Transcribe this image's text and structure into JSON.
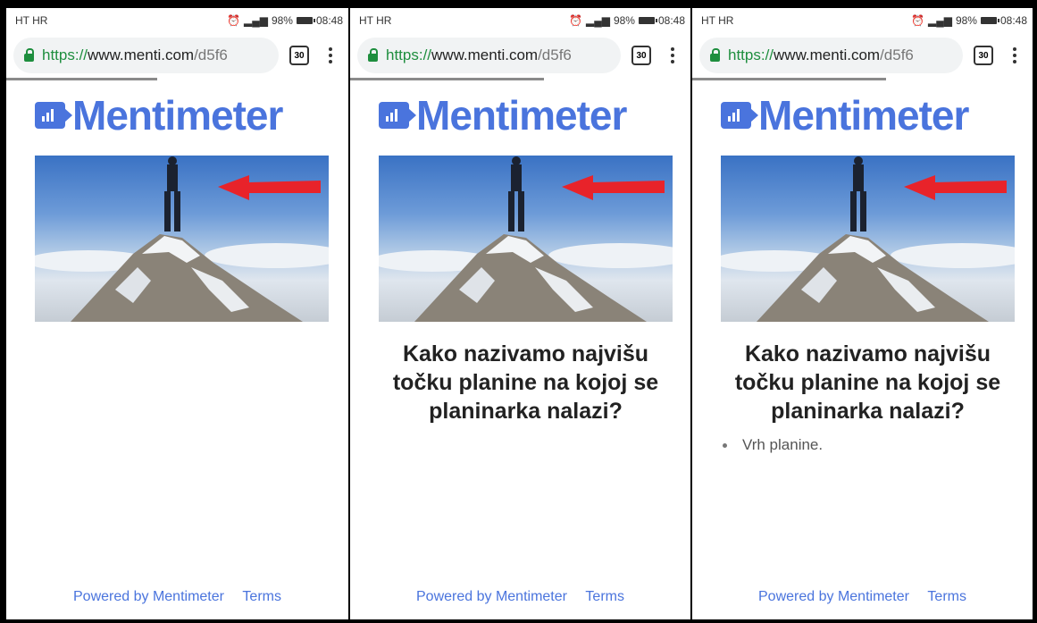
{
  "status": {
    "carrier": "HT HR",
    "battery": "98%",
    "time": "08:48"
  },
  "browser": {
    "url_scheme": "https://",
    "url_host": "www.menti.com",
    "url_path": "/d5f6",
    "tab_count": "30"
  },
  "logo": {
    "text": "Mentimeter",
    "color": "#4a74dd"
  },
  "question": {
    "text": "Kako nazivamo najvišu točku planine na kojoj se planinarka nalazi?"
  },
  "answers": [
    "Vrh planine."
  ],
  "footer": {
    "powered": "Powered by Mentimeter",
    "terms": "Terms"
  },
  "photo": {
    "subject": "climber-on-mountain-summit",
    "arrow_color": "#e8232a"
  }
}
